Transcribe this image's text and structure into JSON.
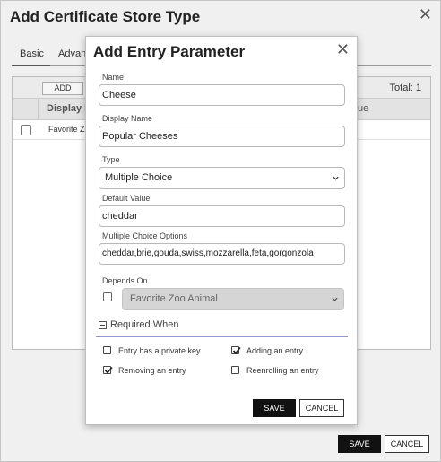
{
  "outer": {
    "title": "Add Certificate Store Type",
    "close_icon": "close-icon",
    "tabs": [
      {
        "label": "Basic"
      },
      {
        "label": "Advan"
      }
    ],
    "toolbar": {
      "add_label": "ADD",
      "total_text": "Total: 1"
    },
    "grid": {
      "columns": [
        {
          "label": "Display N"
        },
        {
          "label": "ue"
        }
      ],
      "rows": [
        {
          "display_name": "Favorite Zo"
        }
      ]
    },
    "save_label": "SAVE",
    "cancel_label": "CANCEL"
  },
  "modal": {
    "title": "Add Entry Parameter",
    "close_icon": "close-icon",
    "name": {
      "label": "Name",
      "value": "Cheese"
    },
    "display_name": {
      "label": "Display Name",
      "value": "Popular Cheeses"
    },
    "type": {
      "label": "Type",
      "value": "Multiple Choice"
    },
    "default_value": {
      "label": "Default Value",
      "value": "cheddar"
    },
    "choice_options": {
      "label": "Multiple Choice Options",
      "value": "cheddar,brie,gouda,swiss,mozzarella,feta,gorgonzola"
    },
    "depends_on": {
      "label": "Depends On",
      "checked": false,
      "value": "Favorite Zoo Animal"
    },
    "required_when": {
      "label": "Required When",
      "options": [
        {
          "label": "Entry has a private key",
          "checked": false
        },
        {
          "label": "Adding an entry",
          "checked": true
        },
        {
          "label": "Removing an entry",
          "checked": true
        },
        {
          "label": "Reenrolling an entry",
          "checked": false
        }
      ]
    },
    "save_label": "SAVE",
    "cancel_label": "CANCEL"
  },
  "colors": {
    "primary_button": "#111111",
    "divider_accent": "#8f98d0",
    "disabled_select": "#d5d5d5"
  }
}
